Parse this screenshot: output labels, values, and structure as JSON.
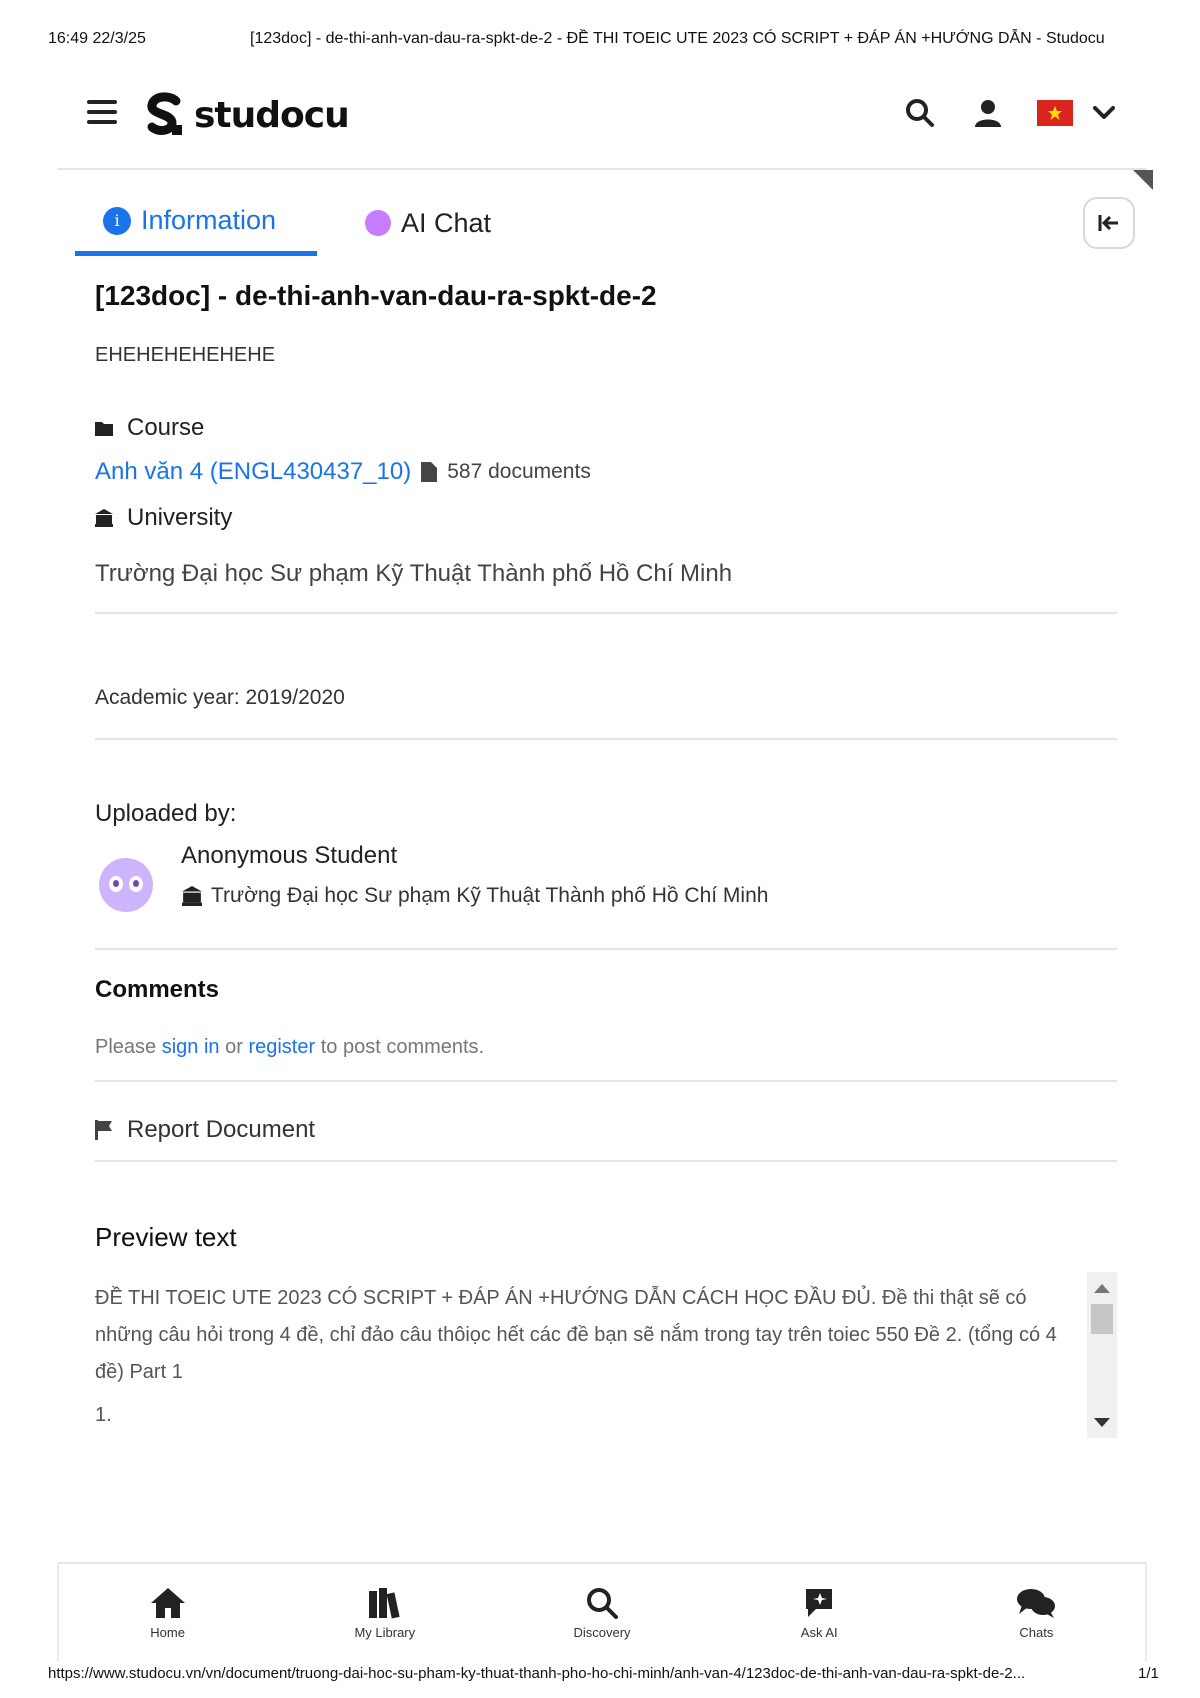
{
  "print_header": {
    "timestamp": "16:49 22/3/25",
    "page_title": "[123doc] - de-thi-anh-van-dau-ra-spkt-de-2 - ĐỀ THI TOEIC UTE 2023 CÓ SCRIPT + ĐÁP ÁN +HƯỚNG DẪN - Studocu"
  },
  "topbar": {
    "logo_text": "studocu",
    "icons": [
      "menu-icon",
      "search-icon",
      "user-icon",
      "vietnam-flag-icon",
      "chevron-down-icon"
    ]
  },
  "tabs": [
    {
      "label": "Information",
      "active": true
    },
    {
      "label": "AI Chat",
      "active": false
    }
  ],
  "document": {
    "title": "[123doc] - de-thi-anh-van-dau-ra-spkt-de-2",
    "description": "EHEHEHEHEHEHE",
    "course_label": "Course",
    "course_name": "Anh văn 4 (ENGL430437_10)",
    "course_doc_count": "587 documents",
    "university_label": "University",
    "university_name": "Trường Đại học Sư phạm Kỹ Thuật Thành phố Hồ Chí Minh",
    "academic_year": "Academic year: 2019/2020"
  },
  "uploader": {
    "label": "Uploaded by:",
    "name": "Anonymous Student",
    "university": "Trường Đại học Sư phạm Kỹ Thuật Thành phố Hồ Chí Minh"
  },
  "comments": {
    "title": "Comments",
    "prefix": "Please",
    "sign_in": "sign in",
    "middle": "or",
    "register": "register",
    "suffix": "to post comments."
  },
  "report": {
    "label": "Report Document"
  },
  "preview": {
    "title": "Preview text",
    "text": "ĐỀ THI TOEIC UTE 2023 CÓ SCRIPT + ĐÁP ÁN +HƯỚNG DẪN CÁCH HỌC ĐẦU ĐỦ. Đề thi thật sẽ có những câu hỏi trong 4 đề, chỉ đảo câu thôiọc hết các đề bạn sẽ nắm trong tay trên toiec 550 Đề 2. (tổng có 4 đề) Part 1",
    "line2": "1."
  },
  "bottom_nav": [
    {
      "label": "Home",
      "icon": "home-icon"
    },
    {
      "label": "My Library",
      "icon": "library-icon"
    },
    {
      "label": "Discovery",
      "icon": "search-icon"
    },
    {
      "label": "Ask AI",
      "icon": "ask-ai-icon"
    },
    {
      "label": "Chats",
      "icon": "chats-icon"
    }
  ],
  "print_footer": {
    "url": "https://www.studocu.vn/vn/document/truong-dai-hoc-su-pham-ky-thuat-thanh-pho-ho-chi-minh/anh-van-4/123doc-de-thi-anh-van-dau-ra-spkt-de-2...",
    "page": "1/1"
  },
  "colors": {
    "accent": "#1a73e8",
    "ai": "#c77dff",
    "avatar": "#cdb4ff",
    "flag_red": "#da251d",
    "flag_star": "#ffdd00"
  }
}
